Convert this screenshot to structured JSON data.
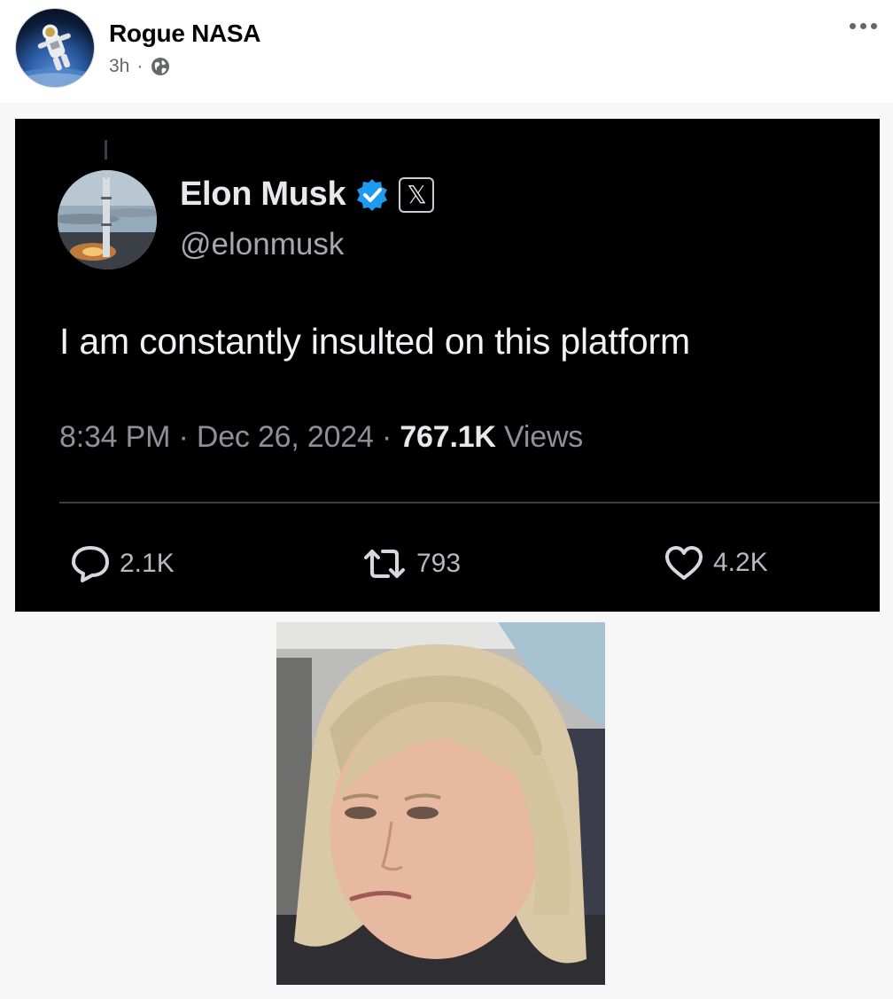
{
  "post": {
    "author_name": "Rogue NASA",
    "time": "3h",
    "separator": "·",
    "privacy_icon": "globe-icon",
    "more_icon": "more-options-icon"
  },
  "tweet": {
    "display_name": "Elon Musk",
    "handle": "@elonmusk",
    "badge_text": "𝕏",
    "verified_color": "#1d9bf0",
    "text": "I am constantly insulted on this platform",
    "time": "8:34 PM",
    "date": "Dec 26, 2024",
    "meta_separator": " · ",
    "views_count": "767.1K",
    "views_label": "Views",
    "replies": "2.1K",
    "retweets": "793",
    "likes": "4.2K"
  },
  "colors": {
    "tweet_background": "#000000",
    "post_background": "#ffffff"
  }
}
